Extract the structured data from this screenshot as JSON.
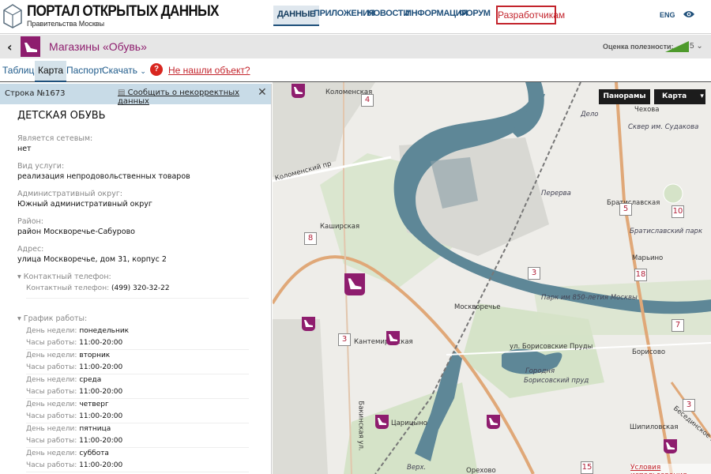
{
  "header": {
    "logo_title": "ПОРТАЛ ОТКРЫТЫХ ДАННЫХ",
    "logo_subtitle": "Правительства Москвы",
    "nav": [
      "ДАННЫЕ",
      "ПРИЛОЖЕНИЯ",
      "НОВОСТИ",
      "ИНФОРМАЦИЯ",
      "ФОРУМ"
    ],
    "developers": "Разработчикам",
    "lang": "ENG"
  },
  "dataset": {
    "title": "Магазины «Обувь»",
    "rating_label": "Оценка полезности:",
    "rating_value": "5"
  },
  "tabs": [
    "Таблица",
    "Карта",
    "Паспорт",
    "Скачать"
  ],
  "not_found": "Не нашли объект?",
  "panel": {
    "row": "Строка №1673",
    "report": "Сообщить о некорректных данных",
    "title": "ДЕТСКАЯ ОБУВЬ",
    "fields": [
      {
        "label": "Является сетевым:",
        "value": "нет"
      },
      {
        "label": "Вид услуги:",
        "value": "реализация непродовольственных товаров"
      },
      {
        "label": "Административный округ:",
        "value": "Южный административный округ"
      },
      {
        "label": "Район:",
        "value": "район Москворечье-Сабурово"
      },
      {
        "label": "Адрес:",
        "value": "улица Москворечье, дом 31, корпус 2"
      }
    ],
    "phone_section": "▾ Контактный телефон:",
    "phone_label": "Контактный телефон:",
    "phone": "(499) 320-32-22",
    "schedule_section": "▾ График работы:",
    "day_label": "День недели:",
    "hours_label": "Часы работы:",
    "schedule": [
      {
        "day": "понедельник",
        "hours": "11:00-20:00"
      },
      {
        "day": "вторник",
        "hours": "11:00-20:00"
      },
      {
        "day": "среда",
        "hours": "11:00-20:00"
      },
      {
        "day": "четверг",
        "hours": "11:00-20:00"
      },
      {
        "day": "пятница",
        "hours": "11:00-20:00"
      },
      {
        "day": "суббота",
        "hours": "11:00-20:00"
      }
    ]
  },
  "map": {
    "panoramas": "Панорамы",
    "layer": "Карта",
    "terms": "Условия использования",
    "labels": [
      "Коломенская",
      "Коломенский пр",
      "Каширская",
      "Дело",
      "Сквер им. Судакова",
      "Перерва",
      "Братиславская",
      "Братиславский парк",
      "Марьино",
      "Парк им 850-летия Москвы",
      "Москворечье",
      "ул. Борисовские Пруды",
      "Борисово",
      "Городня",
      "Борисовский пруд",
      "Шипиловская",
      "Бакинская ул.",
      "Кантемировская",
      "Царицыно",
      "Орехово",
      "Верх.",
      "Бесединское ш.",
      "Чехова"
    ],
    "badges": [
      "4",
      "8",
      "5",
      "10",
      "3",
      "18",
      "3",
      "7",
      "3",
      "15"
    ]
  }
}
